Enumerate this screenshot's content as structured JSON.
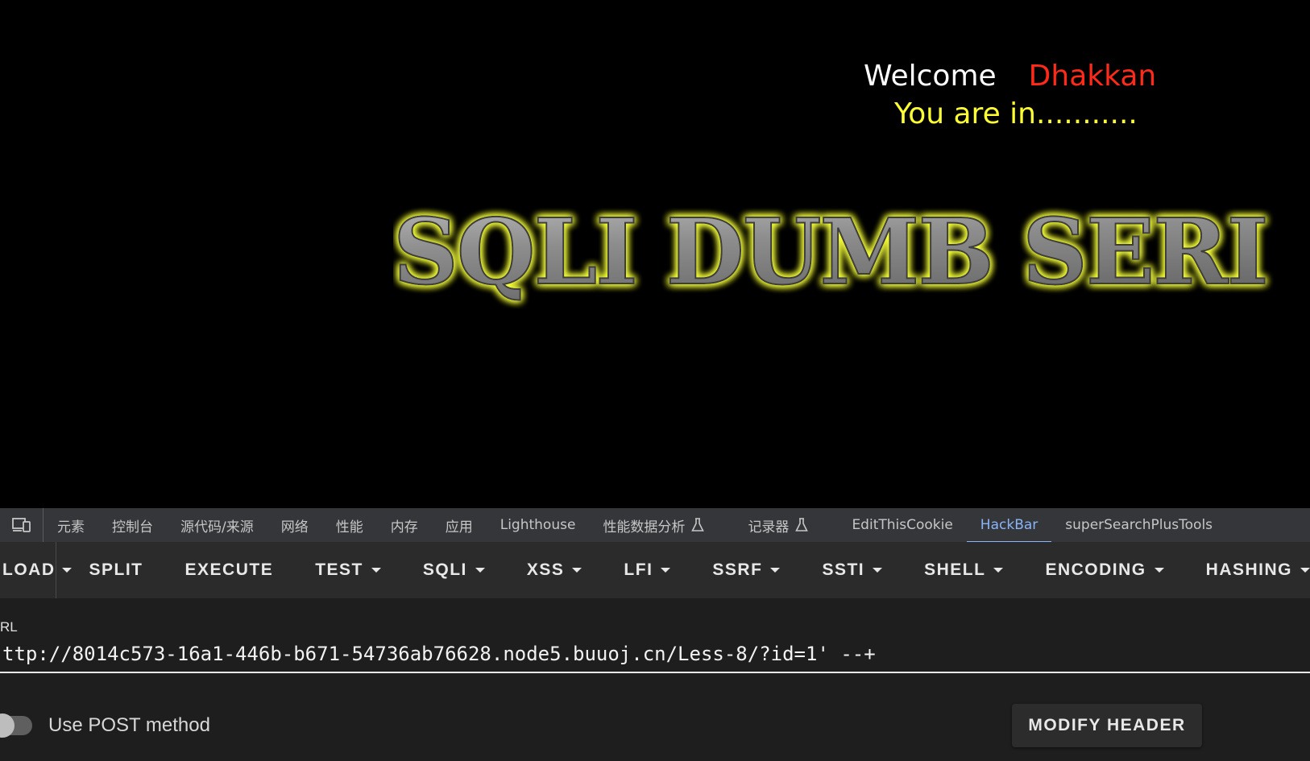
{
  "page": {
    "welcome_word": "Welcome",
    "welcome_user": "Dhakkan",
    "status": "You are in...........",
    "banner_text": "SQLI DUMB SERI"
  },
  "devtools": {
    "tabs": [
      {
        "label": "元素"
      },
      {
        "label": "控制台"
      },
      {
        "label": "源代码/来源"
      },
      {
        "label": "网络"
      },
      {
        "label": "性能"
      },
      {
        "label": "内存"
      },
      {
        "label": "应用"
      },
      {
        "label": "Lighthouse"
      },
      {
        "label": "性能数据分析"
      },
      {
        "label": "记录器"
      },
      {
        "label": "EditThisCookie"
      },
      {
        "label": "HackBar"
      },
      {
        "label": "superSearchPlusTools"
      }
    ],
    "active_tab": "HackBar"
  },
  "hackbar": {
    "toolbar": {
      "load": "LOAD",
      "split": "SPLIT",
      "execute": "EXECUTE",
      "test": "TEST",
      "sqli": "SQLI",
      "xss": "XSS",
      "lfi": "LFI",
      "ssrf": "SSRF",
      "ssti": "SSTI",
      "shell": "SHELL",
      "encoding": "ENCODING",
      "hashing": "HASHING"
    },
    "url_label": "RL",
    "url_value": "ttp://8014c573-16a1-446b-b671-54736ab76628.node5.buuoj.cn/Less-8/?id=1' --+",
    "post_label": "Use POST method",
    "post_enabled": false,
    "modify_header": "MODIFY HEADER"
  },
  "colors": {
    "accent": "#8ab4f8",
    "welcome_user": "#ff2a1a",
    "status": "#ffff33",
    "banner_glow": "#f5ff3a"
  }
}
